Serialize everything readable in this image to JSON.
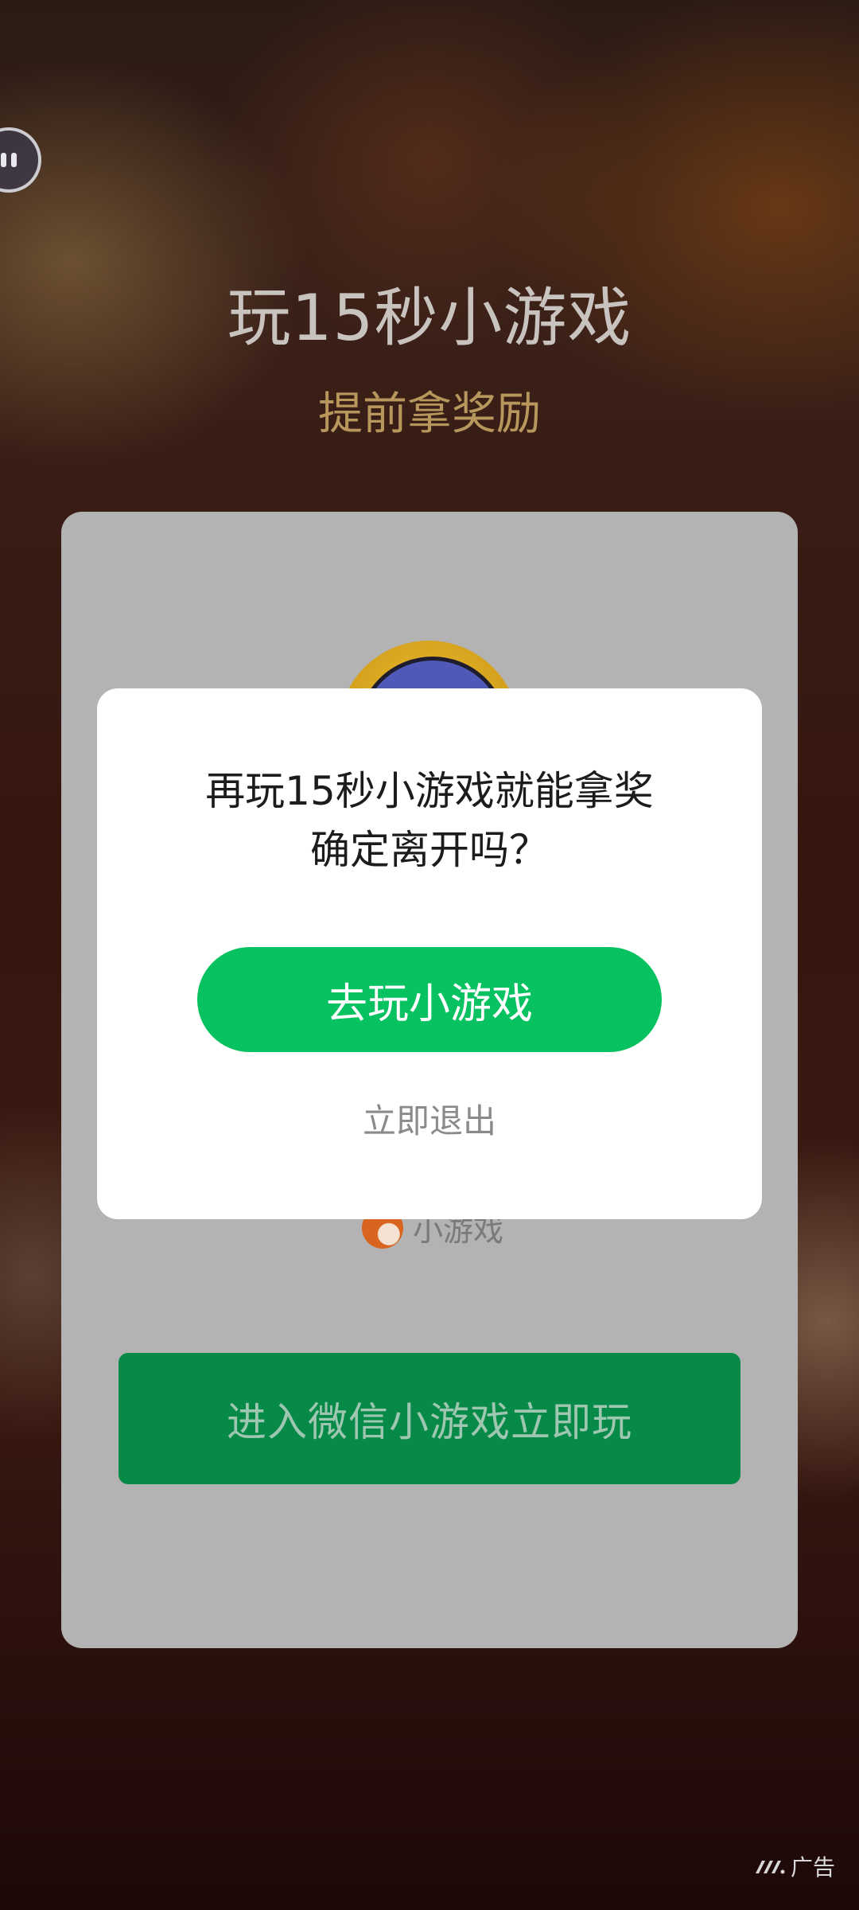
{
  "header": {
    "title": "玩15秒小游戏",
    "subtitle": "提前拿奖励"
  },
  "card": {
    "brand_label": "小游戏",
    "enter_button_label": "进入微信小游戏立即玩"
  },
  "dialog": {
    "message_line1": "再玩15秒小游戏就能拿奖",
    "message_line2": "确定离开吗？",
    "primary_button_label": "去玩小游戏",
    "exit_label": "立即退出"
  },
  "ad": {
    "label": "广告"
  },
  "colors": {
    "accent_green": "#08c261",
    "card_button_green": "#078948",
    "subtitle_gold": "#b8975c"
  }
}
